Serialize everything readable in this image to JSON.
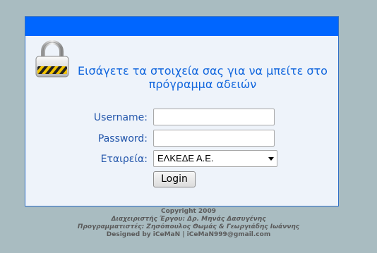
{
  "header": {
    "color": "#0066ff"
  },
  "lock_icon": "padlock-icon",
  "welcome": {
    "line1": "Εισάγετε τα στοιχεία σας για να μπείτε στο",
    "line2": "πρόγραμμα αδειών"
  },
  "form": {
    "username_label": "Username:",
    "username_value": "",
    "password_label": "Password:",
    "password_value": "",
    "company_label": "Εταιρεία:",
    "company_selected": "ΕΛΚΕΔΕ Α.Ε.",
    "login_label": "Login"
  },
  "footer": {
    "copyright": "Copyright 2009",
    "manager": "Διαχειριστής Έργου: Δρ. Μηνάς Δασυγένης",
    "programmers": "Προγραμματιστές: Ζησόπουλος Θωμάς & Γεωργιάδης Ιωάννης",
    "designed_by": "Designed by iCeMaN | iCeMaN999@gmail.com"
  }
}
